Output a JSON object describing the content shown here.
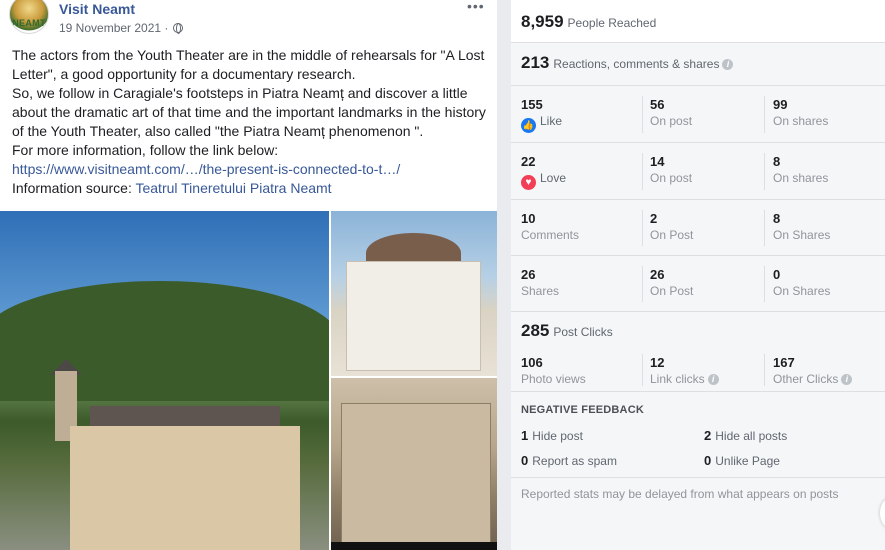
{
  "post": {
    "page_name": "Visit Neamt",
    "avatar_text": "NEAMT",
    "date": "19 November 2021 ·",
    "more_label": "•••",
    "text_lines": [
      "The actors from the Youth Theater are in the middle of rehearsals for \"A Lost Letter\", a good opportunity for a documentary research.",
      "So, we follow in Caragiale's footsteps in Piatra Neamț and discover a little about the dramatic art of that time and the important landmarks in the history of the Youth Theater, also called \"the Piatra Neamț phenomenon \".",
      "For more information, follow the link below:"
    ],
    "link": "https://www.visitneamt.com/…/the-present-is-connected-to-t…/",
    "source_label": "Information source:",
    "source_link": "Teatrul Tineretului Piatra Neamt"
  },
  "insights": {
    "reached": {
      "value": "8,959",
      "label": "People Reached"
    },
    "reactions": {
      "value": "213",
      "label": "Reactions, comments & shares"
    },
    "grid": [
      [
        {
          "value": "155",
          "label": "Like"
        },
        {
          "value": "56",
          "label": "On post"
        },
        {
          "value": "99",
          "label": "On shares"
        }
      ],
      [
        {
          "value": "22",
          "label": "Love"
        },
        {
          "value": "14",
          "label": "On post"
        },
        {
          "value": "8",
          "label": "On shares"
        }
      ],
      [
        {
          "value": "10",
          "label": "Comments"
        },
        {
          "value": "2",
          "label": "On Post"
        },
        {
          "value": "8",
          "label": "On Shares"
        }
      ],
      [
        {
          "value": "26",
          "label": "Shares"
        },
        {
          "value": "26",
          "label": "On Post"
        },
        {
          "value": "0",
          "label": "On Shares"
        }
      ]
    ],
    "clicks": {
      "value": "285",
      "label": "Post Clicks"
    },
    "click_breakdown": [
      {
        "value": "106",
        "label": "Photo views"
      },
      {
        "value": "12",
        "label": "Link clicks"
      },
      {
        "value": "167",
        "label": "Other Clicks"
      }
    ],
    "negative": {
      "title": "NEGATIVE FEEDBACK",
      "items": [
        {
          "value": "1",
          "label": "Hide post"
        },
        {
          "value": "2",
          "label": "Hide all posts"
        },
        {
          "value": "0",
          "label": "Report as spam"
        },
        {
          "value": "0",
          "label": "Unlike Page"
        }
      ]
    },
    "footnote": "Reported stats may be delayed from what appears on posts"
  }
}
